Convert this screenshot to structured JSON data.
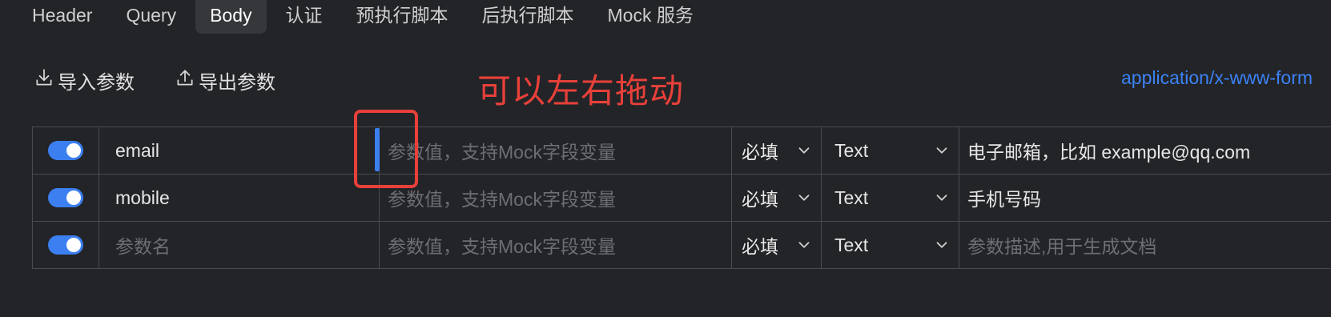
{
  "tabs": [
    {
      "label": "Header",
      "active": false
    },
    {
      "label": "Query",
      "active": false
    },
    {
      "label": "Body",
      "active": true
    },
    {
      "label": "认证",
      "active": false
    },
    {
      "label": "预执行脚本",
      "active": false
    },
    {
      "label": "后执行脚本",
      "active": false
    },
    {
      "label": "Mock 服务",
      "active": false
    }
  ],
  "toolbar": {
    "import_label": "导入参数",
    "export_label": "导出参数",
    "import_icon": "download-icon",
    "export_icon": "upload-icon"
  },
  "annotation": "可以左右拖动",
  "content_type": "application/x-www-form",
  "table": {
    "rows": [
      {
        "enabled": true,
        "name": "email",
        "name_is_placeholder": false,
        "value_placeholder": "参数值，支持Mock字段变量",
        "required": "必填",
        "type": "Text",
        "description": "电子邮箱，比如 example@qq.com",
        "description_is_placeholder": false
      },
      {
        "enabled": true,
        "name": "mobile",
        "name_is_placeholder": false,
        "value_placeholder": "参数值，支持Mock字段变量",
        "required": "必填",
        "type": "Text",
        "description": "手机号码",
        "description_is_placeholder": false
      },
      {
        "enabled": true,
        "name": "参数名",
        "name_is_placeholder": true,
        "value_placeholder": "参数值，支持Mock字段变量",
        "required": "必填",
        "type": "Text",
        "description": "参数描述,用于生成文档",
        "description_is_placeholder": true
      }
    ]
  },
  "colors": {
    "background": "#232427",
    "accent": "#3b7ff0",
    "link": "#3b82f6",
    "annotation": "#e8403a"
  }
}
